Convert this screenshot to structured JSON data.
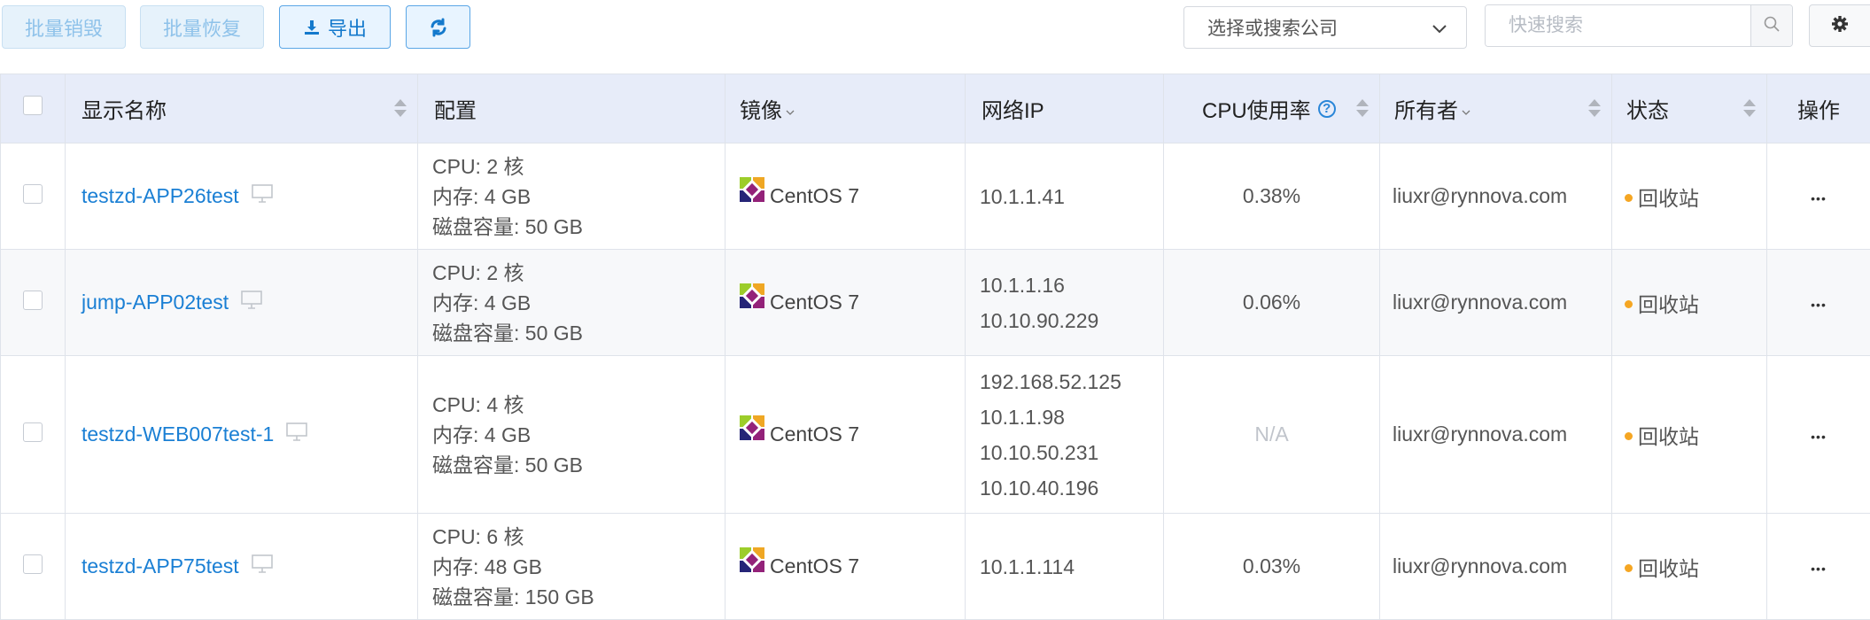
{
  "toolbar": {
    "batch_destroy": "批量销毁",
    "batch_restore": "批量恢复",
    "export": "导出",
    "company_select": "选择或搜索公司",
    "search_placeholder": "快速搜索"
  },
  "columns": {
    "name": "显示名称",
    "config": "配置",
    "image": "镜像",
    "ip": "网络IP",
    "cpu": "CPU使用率",
    "owner": "所有者",
    "status": "状态",
    "ops": "操作"
  },
  "rows": [
    {
      "name": "testzd-APP26test",
      "cpu_line": "CPU: 2 核",
      "mem_line": "内存: 4 GB",
      "disk_line": "磁盘容量: 50 GB",
      "image": "CentOS 7",
      "ip1": "10.1.1.41",
      "cpu_usage": "0.38%",
      "owner": "liuxr@rynnova.com",
      "status": "回收站",
      "ops": "•••"
    },
    {
      "name": "jump-APP02test",
      "cpu_line": "CPU: 2 核",
      "mem_line": "内存: 4 GB",
      "disk_line": "磁盘容量: 50 GB",
      "image": "CentOS 7",
      "ip1": "10.1.1.16",
      "ip2": "10.10.90.229",
      "cpu_usage": "0.06%",
      "owner": "liuxr@rynnova.com",
      "status": "回收站",
      "ops": "•••"
    },
    {
      "name": "testzd-WEB007test-1",
      "cpu_line": "CPU: 4 核",
      "mem_line": "内存: 4 GB",
      "disk_line": "磁盘容量: 50 GB",
      "image": "CentOS 7",
      "ip1": "192.168.52.125",
      "ip2": "10.1.1.98",
      "ip3": "10.10.50.231",
      "ip4": "10.10.40.196",
      "cpu_usage": "N/A",
      "owner": "liuxr@rynnova.com",
      "status": "回收站",
      "ops": "•••"
    },
    {
      "name": "testzd-APP75test",
      "cpu_line": "CPU: 6 核",
      "mem_line": "内存: 48 GB",
      "disk_line": "磁盘容量: 150 GB",
      "image": "CentOS 7",
      "ip1": "10.1.1.114",
      "cpu_usage": "0.03%",
      "owner": "liuxr@rynnova.com",
      "status": "回收站",
      "ops": "•••"
    }
  ],
  "colors": {
    "link": "#1a7fd4",
    "accent": "#1479cc",
    "status_dot": "#f5a623",
    "header_bg": "#e7ecf9"
  }
}
